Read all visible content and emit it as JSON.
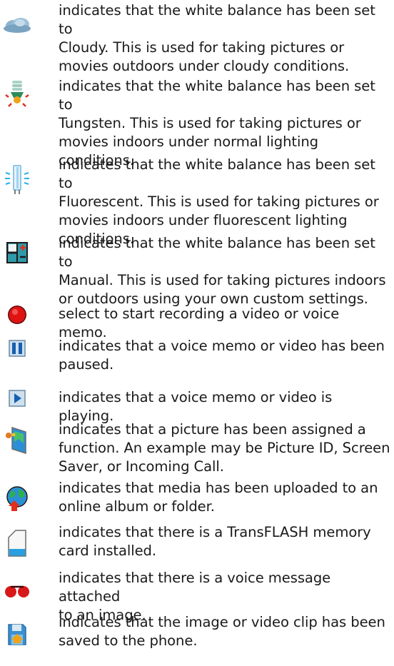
{
  "items": [
    {
      "icon": "cloudy-wb-icon",
      "lines": [
        "indicates that the white balance has been set to",
        "Cloudy. This is used for taking pictures or",
        "movies outdoors under cloudy conditions."
      ]
    },
    {
      "icon": "tungsten-wb-icon",
      "lines": [
        "indicates that the white balance has been set to",
        "Tungsten. This is used for taking pictures or",
        "movies indoors under normal lighting",
        "conditions."
      ]
    },
    {
      "icon": "fluorescent-wb-icon",
      "lines": [
        "indicates that the white balance has been set to",
        "Fluorescent. This is used for taking pictures or",
        "movies indoors under fluorescent lighting",
        "conditions."
      ]
    },
    {
      "icon": "manual-wb-icon",
      "lines": [
        "indicates that the white balance has been set to",
        "Manual. This is used for taking pictures indoors",
        "or outdoors using your own custom settings."
      ]
    },
    {
      "icon": "record-icon",
      "lines": [
        "select to start recording a video or voice memo."
      ]
    },
    {
      "icon": "pause-icon",
      "lines": [
        "indicates that a voice memo or video has been",
        "paused."
      ]
    },
    {
      "icon": "play-icon",
      "lines": [
        "indicates that a voice memo or video is playing."
      ]
    },
    {
      "icon": "assigned-picture-icon",
      "lines": [
        "indicates that a picture has been assigned a",
        "function. An example may be Picture ID, Screen",
        "Saver, or Incoming Call."
      ]
    },
    {
      "icon": "uploaded-globe-icon",
      "lines": [
        "indicates that media has been uploaded to an",
        "online album or folder."
      ]
    },
    {
      "icon": "memory-card-icon",
      "lines": [
        "indicates that there is a TransFLASH memory",
        "card installed."
      ]
    },
    {
      "icon": "voice-attached-icon",
      "lines": [
        "indicates that there is a voice message attached",
        "to an image."
      ]
    },
    {
      "icon": "saved-to-phone-icon",
      "lines": [
        "indicates that the image or video clip has been",
        "saved to the phone."
      ]
    }
  ]
}
